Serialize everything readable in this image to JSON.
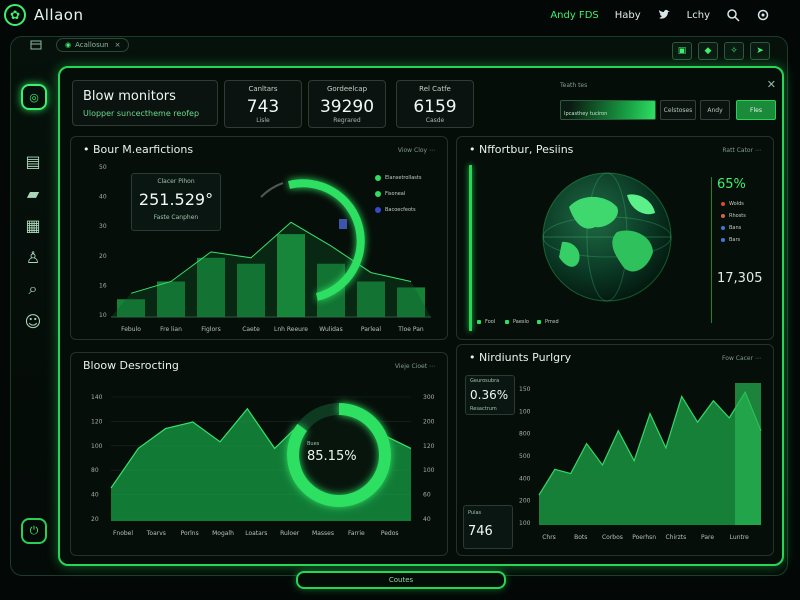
{
  "app": {
    "title": "Allaon",
    "logo_icon": "leaf-icon"
  },
  "topbar": {
    "accent_item": "Andy FDS",
    "items": [
      "Haby",
      "Lchy"
    ],
    "icons": [
      "twitter-icon",
      "search-icon",
      "settings-icon"
    ]
  },
  "toolbar": {
    "pill": "Acallosun",
    "right_buttons": [
      "save-icon",
      "diamond-icon",
      "star-icon",
      "send-icon"
    ]
  },
  "sidebar": {
    "icons": [
      "grid-icon",
      "folder-icon",
      "table-icon",
      "users-icon",
      "search-icon",
      "profile-icon"
    ]
  },
  "header": {
    "title": "Blow monitors",
    "subtitle": "Ulopper suncectheme reofep",
    "stats": [
      {
        "label": "Canltars",
        "value": "743",
        "sub": "Lisle"
      },
      {
        "label": "Gordeelcap",
        "value": "39290",
        "sub": "Regrared"
      },
      {
        "label": "Rel Catfe",
        "value": "6159",
        "sub": "Casde"
      }
    ]
  },
  "filter": {
    "label": "Teath tes",
    "bar_text": "Ipcasthey tuciron",
    "buttons": [
      "Celstoses",
      "Andy",
      "Fles"
    ],
    "close_icon": "close-icon",
    "accent": "#2ee062"
  },
  "panel1": {
    "title": "Bour M.earfictions",
    "link": "Viow  Cloy",
    "big_label": "Clacer Pihon",
    "big_value": "251.529°",
    "big_sub": "Faste Canphen",
    "legend": [
      "Elansetrollasts",
      "Fisoneal",
      "Bacoecfeots"
    ],
    "legend_colors": [
      "#2ee062",
      "#2ee062",
      "#3b49c9"
    ]
  },
  "panel2": {
    "title": "Nffortbur, Pesiins",
    "link": "Ratt  Cator",
    "percent": "65%",
    "rows": [
      "Wolds",
      "Rhosts",
      "Bans",
      "Bars"
    ],
    "row_colors": [
      "#e04a2c",
      "#d06a3a",
      "#3a7ad8",
      "#3a7ad8"
    ],
    "value": "17,305",
    "legend": [
      "Fool",
      "Paeslo",
      "Pmsd"
    ]
  },
  "panel3": {
    "title": "Bloow Desrocting",
    "link": "Vieje  Cioet",
    "donut_label": "Bues",
    "donut_value": "85.15%"
  },
  "panel4": {
    "title": "Nirdiunts Purlgry",
    "link": "Fow  Cacer",
    "top_label": "Geurosubra",
    "top_value": "0.36%",
    "top_sub": "Resactrum",
    "bottom_label": "Pulas",
    "bottom_value": "746"
  },
  "footer": {
    "tab": "Coutes"
  },
  "chart_data": [
    {
      "type": "bar",
      "title": "Bour M.earfictions",
      "categories": [
        "Febulo",
        "Fre lian",
        "Figlors",
        "Caete",
        "Lnh Reeure",
        "Wulidas",
        "Parleal",
        "Tloe Pan"
      ],
      "values": [
        6,
        12,
        20,
        18,
        28,
        18,
        12,
        10
      ],
      "series_line": [
        8,
        12,
        22,
        20,
        32,
        24,
        15,
        12
      ],
      "y_ticks": [
        "50",
        "40",
        "30",
        "20",
        "16",
        "10"
      ],
      "ylim": [
        0,
        50
      ]
    },
    {
      "type": "area",
      "title": "Bloow Desrocting",
      "x": [
        "Fnobel",
        "Toarvs",
        "Porlns",
        "Mogalh",
        "Loatars",
        "Ruloer",
        "Masses",
        "Farrie",
        "Pedos"
      ],
      "values": [
        10,
        22,
        28,
        30,
        24,
        34,
        22,
        30,
        16,
        32,
        26,
        22
      ],
      "y_ticks_left": [
        "140",
        "120",
        "100",
        "80",
        "40",
        "20"
      ],
      "y_ticks_right": [
        "300",
        "200",
        "120",
        "100",
        "60",
        "40"
      ]
    },
    {
      "type": "area",
      "title": "Nirdiunts Purlgry",
      "x": [
        "Chrs",
        "Bots",
        "Corbos",
        "Poerhsn",
        "Chirzts",
        "Pare",
        "Luntre"
      ],
      "values": [
        14,
        26,
        24,
        38,
        28,
        44,
        30,
        52,
        36,
        60,
        48,
        58,
        50,
        62,
        44
      ],
      "y_ticks": [
        "150",
        "100",
        "800",
        "500",
        "400",
        "200",
        "100"
      ]
    }
  ]
}
